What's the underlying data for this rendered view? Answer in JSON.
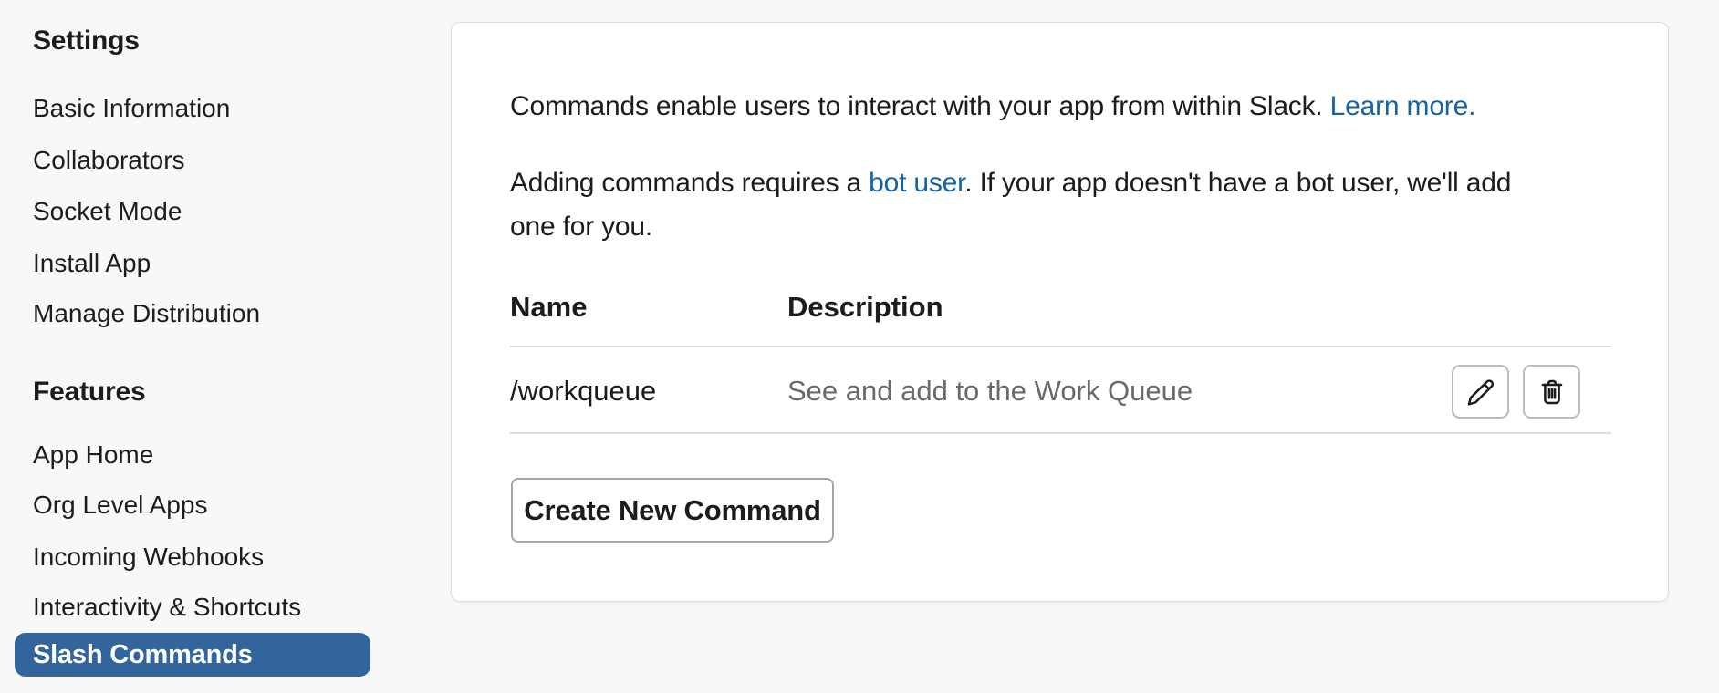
{
  "colors": {
    "page_background": "#f8f8f8",
    "card_background": "#ffffff",
    "text_primary": "#1d1c1d",
    "text_muted": "#6a6a6a",
    "link_blue": "#1264a3",
    "active_nav_blue": "#31659c",
    "divider_gray": "#dcdcdc"
  },
  "sidebar": {
    "sections": [
      {
        "heading": "Settings",
        "items": [
          {
            "label": "Basic Information"
          },
          {
            "label": "Collaborators"
          },
          {
            "label": "Socket Mode"
          },
          {
            "label": "Install App"
          },
          {
            "label": "Manage Distribution"
          }
        ]
      },
      {
        "heading": "Features",
        "items": [
          {
            "label": "App Home"
          },
          {
            "label": "Org Level Apps"
          },
          {
            "label": "Incoming Webhooks"
          },
          {
            "label": "Interactivity & Shortcuts"
          },
          {
            "label": "Slash Commands",
            "active": true
          }
        ]
      }
    ]
  },
  "main": {
    "intro": {
      "p1_text": "Commands enable users to interact with your app from within Slack. ",
      "p1_link": "Learn more.",
      "p2_before_link": "Adding commands requires a ",
      "p2_link": "bot user",
      "p2_after_link": ". If your app doesn't have a bot user, we'll add",
      "p2_line2": "one for you."
    },
    "table": {
      "columns": [
        "Name",
        "Description"
      ],
      "rows": [
        {
          "name": "/workqueue",
          "description": "See and add to the Work Queue"
        }
      ]
    },
    "row_actions": {
      "edit_icon": "pencil-icon",
      "delete_icon": "trash-icon"
    },
    "create_button_label": "Create New Command"
  }
}
